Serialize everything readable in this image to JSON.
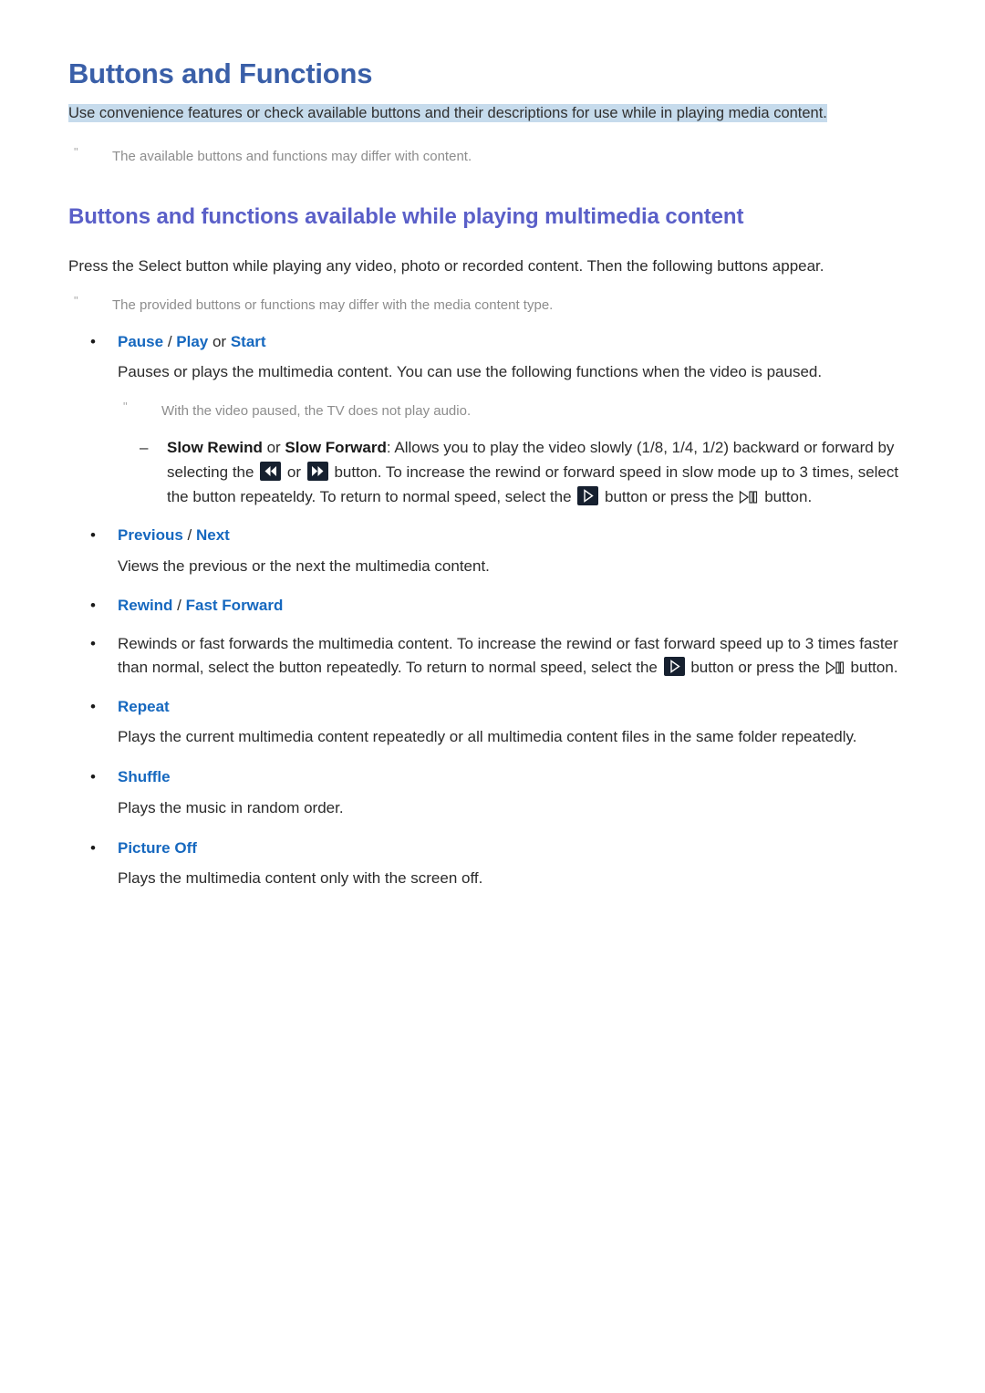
{
  "document": {
    "title": "Buttons and Functions",
    "subtitle": "Use convenience features or check available buttons and their descriptions for use while in playing media content.",
    "top_note": "The available buttons and functions may differ with content.",
    "note_marker": "\"",
    "colors": {
      "title": "#3a5fa8",
      "subtitle_highlight": "#c6dbec",
      "section_heading": "#5a5fc8",
      "bullet_label": "#1668bf",
      "body_text": "#2b2b2b",
      "note_text": "#8d8d8d",
      "key_button_bg": "#16202f"
    }
  },
  "section": {
    "heading": "Buttons and functions available while playing multimedia content",
    "intro": "Press the Select button while playing any video, photo or recorded content. Then the following buttons appear.",
    "note": "The provided buttons or functions may differ with the media content type."
  },
  "bullets": {
    "pause": {
      "bullet": "•",
      "label_1": "Pause",
      "separator": " / ",
      "label_2": "Play",
      "conjunction": " or ",
      "label_3": "Start",
      "description": "Pauses or plays the multimedia content. You can use the following functions when the video is paused.",
      "note": "With the video paused, the TV does not play audio."
    },
    "slow": {
      "dash": "–",
      "strong_1": "Slow Rewind",
      "mid_1": " or ",
      "strong_2": "Slow Forward",
      "text_1": ": Allows you to play the video slowly (1/8, 1/4, 1/2) backward or forward by selecting the ",
      "text_2": " or ",
      "text_3": " button. To increase the rewind or forward speed in slow mode up to 3 times, select the button repeateldy. To return to normal speed, select the ",
      "text_4": " button or press the ",
      "text_5": " button."
    },
    "previous": {
      "bullet": "•",
      "label_1": "Previous",
      "separator": " / ",
      "label_2": "Next",
      "description": "Views the previous or the next the multimedia content."
    },
    "rewind": {
      "bullet": "•",
      "label_1": "Rewind",
      "separator": " / ",
      "label_2": "Fast Forward",
      "desc_bullet": "•",
      "desc_1": "Rewinds or fast forwards the multimedia content. To increase the rewind or fast forward speed up to 3 times faster than normal, select the button repeatedly. To return to normal speed, select the ",
      "desc_2": " button or press the ",
      "desc_3": " button."
    },
    "repeat": {
      "bullet": "•",
      "label": "Repeat",
      "description": "Plays the current multimedia content repeatedly or all multimedia content files in the same folder repeatedly."
    },
    "shuffle": {
      "bullet": "•",
      "label": "Shuffle",
      "description": "Plays the music in random order."
    },
    "picture_off": {
      "bullet": "•",
      "label": "Picture Off",
      "description": "Plays the multimedia content only with the screen off."
    }
  },
  "key_glyphs": {
    "slow_rewind": "slow-rewind-key",
    "slow_forward": "slow-forward-key",
    "play": "play-key",
    "play_pause": "play-pause-key"
  }
}
